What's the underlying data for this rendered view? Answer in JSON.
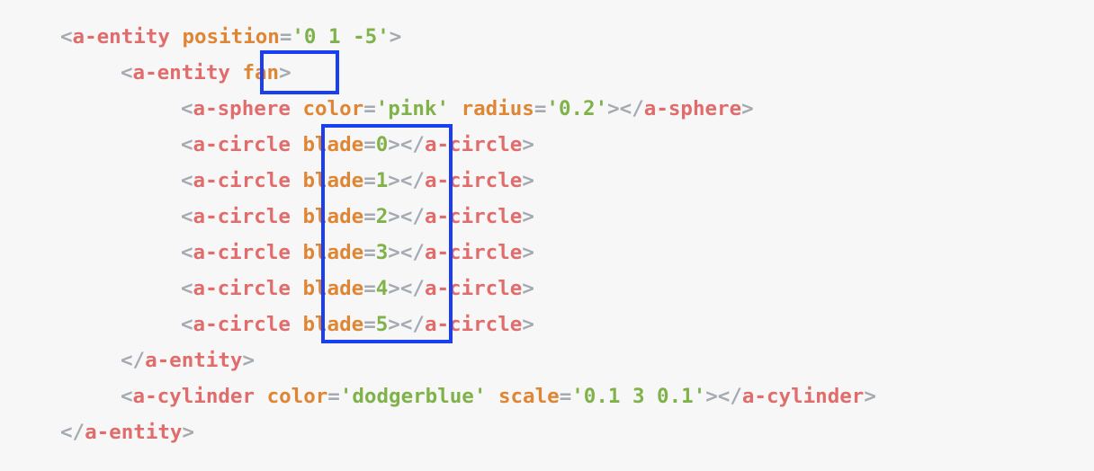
{
  "code_lines": [
    [
      {
        "t": "<",
        "c": "punct"
      },
      {
        "t": "a-entity",
        "c": "tag"
      },
      {
        "t": " ",
        "c": "punct"
      },
      {
        "t": "position",
        "c": "attr"
      },
      {
        "t": "=",
        "c": "punct"
      },
      {
        "t": "'0 1 -5'",
        "c": "val"
      },
      {
        "t": ">",
        "c": "punct"
      }
    ],
    [
      {
        "t": "<",
        "c": "punct"
      },
      {
        "t": "a-entity",
        "c": "tag"
      },
      {
        "t": " ",
        "c": "punct"
      },
      {
        "t": "fan",
        "c": "attr"
      },
      {
        "t": ">",
        "c": "punct"
      }
    ],
    [
      {
        "t": "<",
        "c": "punct"
      },
      {
        "t": "a-sphere",
        "c": "tag"
      },
      {
        "t": " ",
        "c": "punct"
      },
      {
        "t": "color",
        "c": "attr"
      },
      {
        "t": "=",
        "c": "punct"
      },
      {
        "t": "'pink'",
        "c": "val"
      },
      {
        "t": " ",
        "c": "punct"
      },
      {
        "t": "radius",
        "c": "attr"
      },
      {
        "t": "=",
        "c": "punct"
      },
      {
        "t": "'0.2'",
        "c": "val"
      },
      {
        "t": "></",
        "c": "punct"
      },
      {
        "t": "a-sphere",
        "c": "tag"
      },
      {
        "t": ">",
        "c": "punct"
      }
    ],
    [
      {
        "t": "<",
        "c": "punct"
      },
      {
        "t": "a-circle",
        "c": "tag"
      },
      {
        "t": " ",
        "c": "punct"
      },
      {
        "t": "blade",
        "c": "attr"
      },
      {
        "t": "=",
        "c": "punct"
      },
      {
        "t": "0",
        "c": "val"
      },
      {
        "t": "></",
        "c": "punct"
      },
      {
        "t": "a-circle",
        "c": "tag"
      },
      {
        "t": ">",
        "c": "punct"
      }
    ],
    [
      {
        "t": "<",
        "c": "punct"
      },
      {
        "t": "a-circle",
        "c": "tag"
      },
      {
        "t": " ",
        "c": "punct"
      },
      {
        "t": "blade",
        "c": "attr"
      },
      {
        "t": "=",
        "c": "punct"
      },
      {
        "t": "1",
        "c": "val"
      },
      {
        "t": "></",
        "c": "punct"
      },
      {
        "t": "a-circle",
        "c": "tag"
      },
      {
        "t": ">",
        "c": "punct"
      }
    ],
    [
      {
        "t": "<",
        "c": "punct"
      },
      {
        "t": "a-circle",
        "c": "tag"
      },
      {
        "t": " ",
        "c": "punct"
      },
      {
        "t": "blade",
        "c": "attr"
      },
      {
        "t": "=",
        "c": "punct"
      },
      {
        "t": "2",
        "c": "val"
      },
      {
        "t": "></",
        "c": "punct"
      },
      {
        "t": "a-circle",
        "c": "tag"
      },
      {
        "t": ">",
        "c": "punct"
      }
    ],
    [
      {
        "t": "<",
        "c": "punct"
      },
      {
        "t": "a-circle",
        "c": "tag"
      },
      {
        "t": " ",
        "c": "punct"
      },
      {
        "t": "blade",
        "c": "attr"
      },
      {
        "t": "=",
        "c": "punct"
      },
      {
        "t": "3",
        "c": "val"
      },
      {
        "t": "></",
        "c": "punct"
      },
      {
        "t": "a-circle",
        "c": "tag"
      },
      {
        "t": ">",
        "c": "punct"
      }
    ],
    [
      {
        "t": "<",
        "c": "punct"
      },
      {
        "t": "a-circle",
        "c": "tag"
      },
      {
        "t": " ",
        "c": "punct"
      },
      {
        "t": "blade",
        "c": "attr"
      },
      {
        "t": "=",
        "c": "punct"
      },
      {
        "t": "4",
        "c": "val"
      },
      {
        "t": "></",
        "c": "punct"
      },
      {
        "t": "a-circle",
        "c": "tag"
      },
      {
        "t": ">",
        "c": "punct"
      }
    ],
    [
      {
        "t": "<",
        "c": "punct"
      },
      {
        "t": "a-circle",
        "c": "tag"
      },
      {
        "t": " ",
        "c": "punct"
      },
      {
        "t": "blade",
        "c": "attr"
      },
      {
        "t": "=",
        "c": "punct"
      },
      {
        "t": "5",
        "c": "val"
      },
      {
        "t": "></",
        "c": "punct"
      },
      {
        "t": "a-circle",
        "c": "tag"
      },
      {
        "t": ">",
        "c": "punct"
      }
    ],
    [
      {
        "t": "</",
        "c": "punct"
      },
      {
        "t": "a-entity",
        "c": "tag"
      },
      {
        "t": ">",
        "c": "punct"
      }
    ],
    [
      {
        "t": "<",
        "c": "punct"
      },
      {
        "t": "a-cylinder",
        "c": "tag"
      },
      {
        "t": " ",
        "c": "punct"
      },
      {
        "t": "color",
        "c": "attr"
      },
      {
        "t": "=",
        "c": "punct"
      },
      {
        "t": "'dodgerblue'",
        "c": "val"
      },
      {
        "t": " ",
        "c": "punct"
      },
      {
        "t": "scale",
        "c": "attr"
      },
      {
        "t": "=",
        "c": "punct"
      },
      {
        "t": "'0.1 3 0.1'",
        "c": "val"
      },
      {
        "t": "></",
        "c": "punct"
      },
      {
        "t": "a-cylinder",
        "c": "tag"
      },
      {
        "t": ">",
        "c": "punct"
      }
    ],
    [
      {
        "t": "</",
        "c": "punct"
      },
      {
        "t": "a-entity",
        "c": "tag"
      },
      {
        "t": ">",
        "c": "punct"
      }
    ]
  ],
  "highlight_color": "#1a3ff2",
  "syntax_colors": {
    "punct": "#a3aab1",
    "tag": "#e06c6c",
    "attr": "#df8635",
    "val": "#80b24a"
  }
}
